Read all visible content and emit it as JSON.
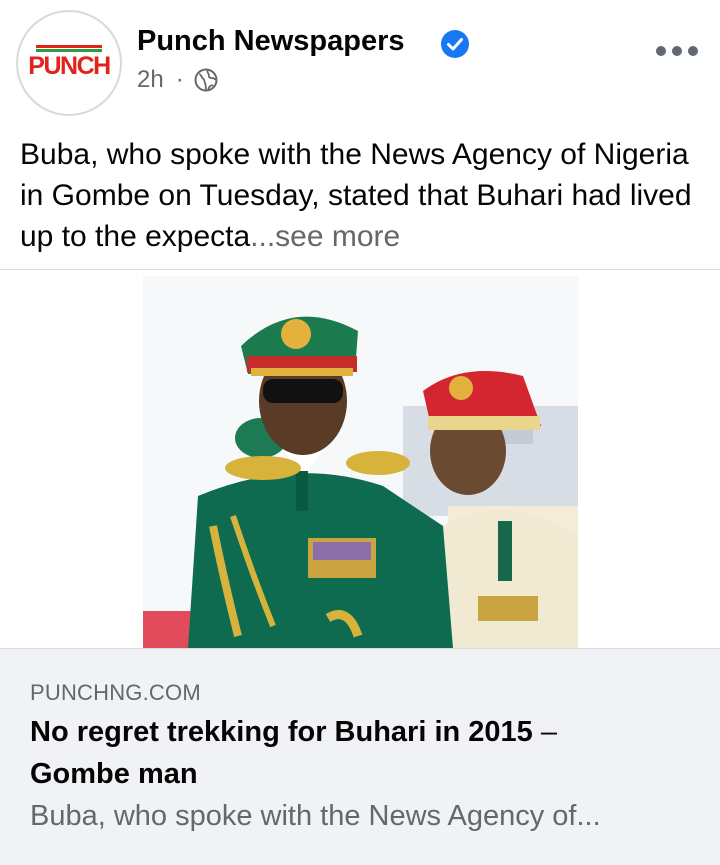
{
  "post": {
    "page_name": "Punch Newspapers",
    "verified_icon": "verified-badge-icon",
    "time": "2h",
    "separator": "·",
    "audience_icon": "globe-icon",
    "more_icon": "more-options-icon",
    "text": "Buba, who spoke with the News Agency of Nigeria in Gombe on Tuesday, stated that Buhari had lived up to the expecta",
    "see_more": "...see more"
  },
  "logo": {
    "text": "PUNCH",
    "colors": {
      "primary": "#e2231a",
      "accent": "#2e9a3e"
    }
  },
  "link_preview": {
    "domain": "PUNCHNG.COM",
    "title": "No regret trekking for Buhari in 2015",
    "title_dash": " – ",
    "title_cont": "Gombe man",
    "description": "Buba, who spoke with the News Agency of..."
  },
  "colors": {
    "verified": "#1877f2",
    "secondary_text": "#65676b",
    "card_bg": "#f0f2f5"
  }
}
